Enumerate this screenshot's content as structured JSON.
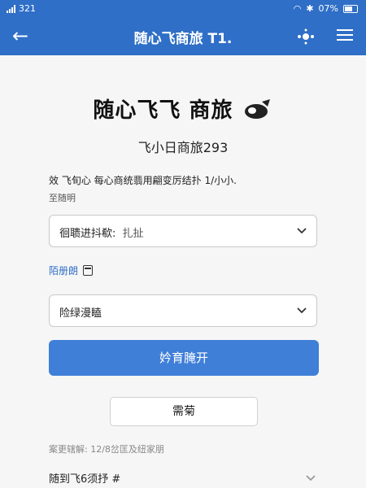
{
  "status": {
    "time": "321",
    "battery": "07%"
  },
  "app_bar": {
    "title": "随心飞商旅 T1."
  },
  "brand": {
    "name": "随心飞飞 商旅"
  },
  "subtitle": "飞小日商旅293",
  "notice": {
    "line1": "效  飞旬心  每心商统翡用翩变厉结扑 1/小小.",
    "line2": "至随明"
  },
  "select1": {
    "label": "徊聩进抖欷:",
    "value": "扎扯"
  },
  "field_label": "陌册朗",
  "select2": {
    "label": "险绿漫瞌"
  },
  "primary_button": "妗育腌开",
  "secondary_button": "需菊",
  "footer": {
    "note": "案更辖解:    12/8岔匡及纽家朋",
    "row": "随到飞6须抒 #"
  },
  "colors": {
    "primary": "#2f6fc7",
    "button": "#3f7fd8"
  }
}
